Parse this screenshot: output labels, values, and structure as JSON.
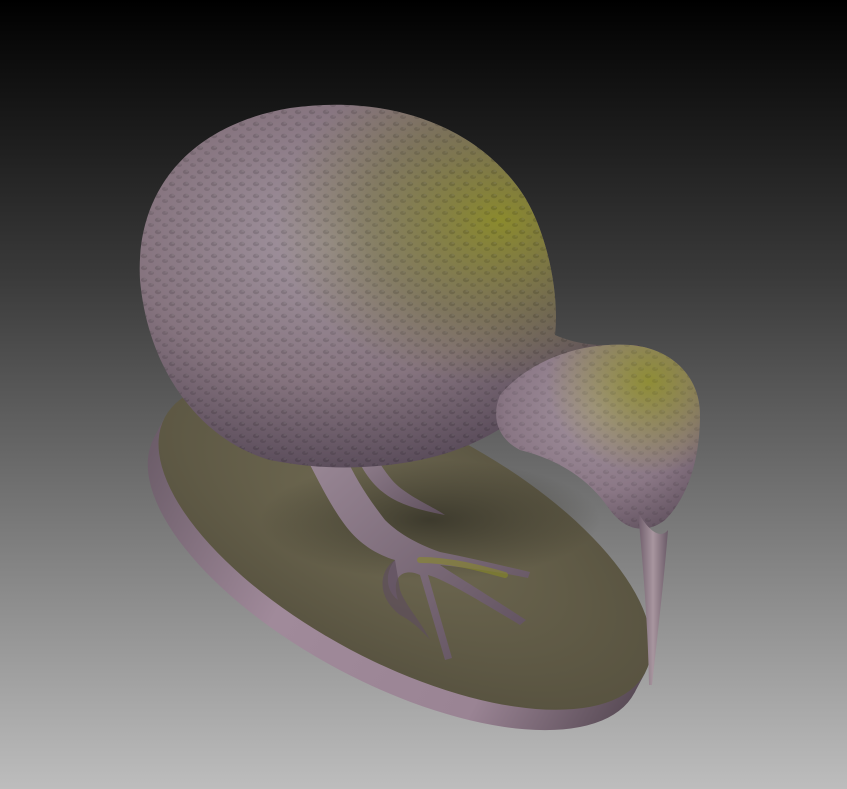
{
  "scene": {
    "subject": "kiwi-bird-sculpture",
    "view": "3d-render-perspective",
    "colors": {
      "background_top": "#000000",
      "background_bottom": "#bdbdbd",
      "base_top": "#6a6650",
      "base_side": "#9c8696",
      "body": "#8e7a8c",
      "body_shadow": "#5e4f5d",
      "body_highlight": "#a69aa4",
      "key_light": "#8a8c1c",
      "beak": "#a08c9c"
    }
  }
}
